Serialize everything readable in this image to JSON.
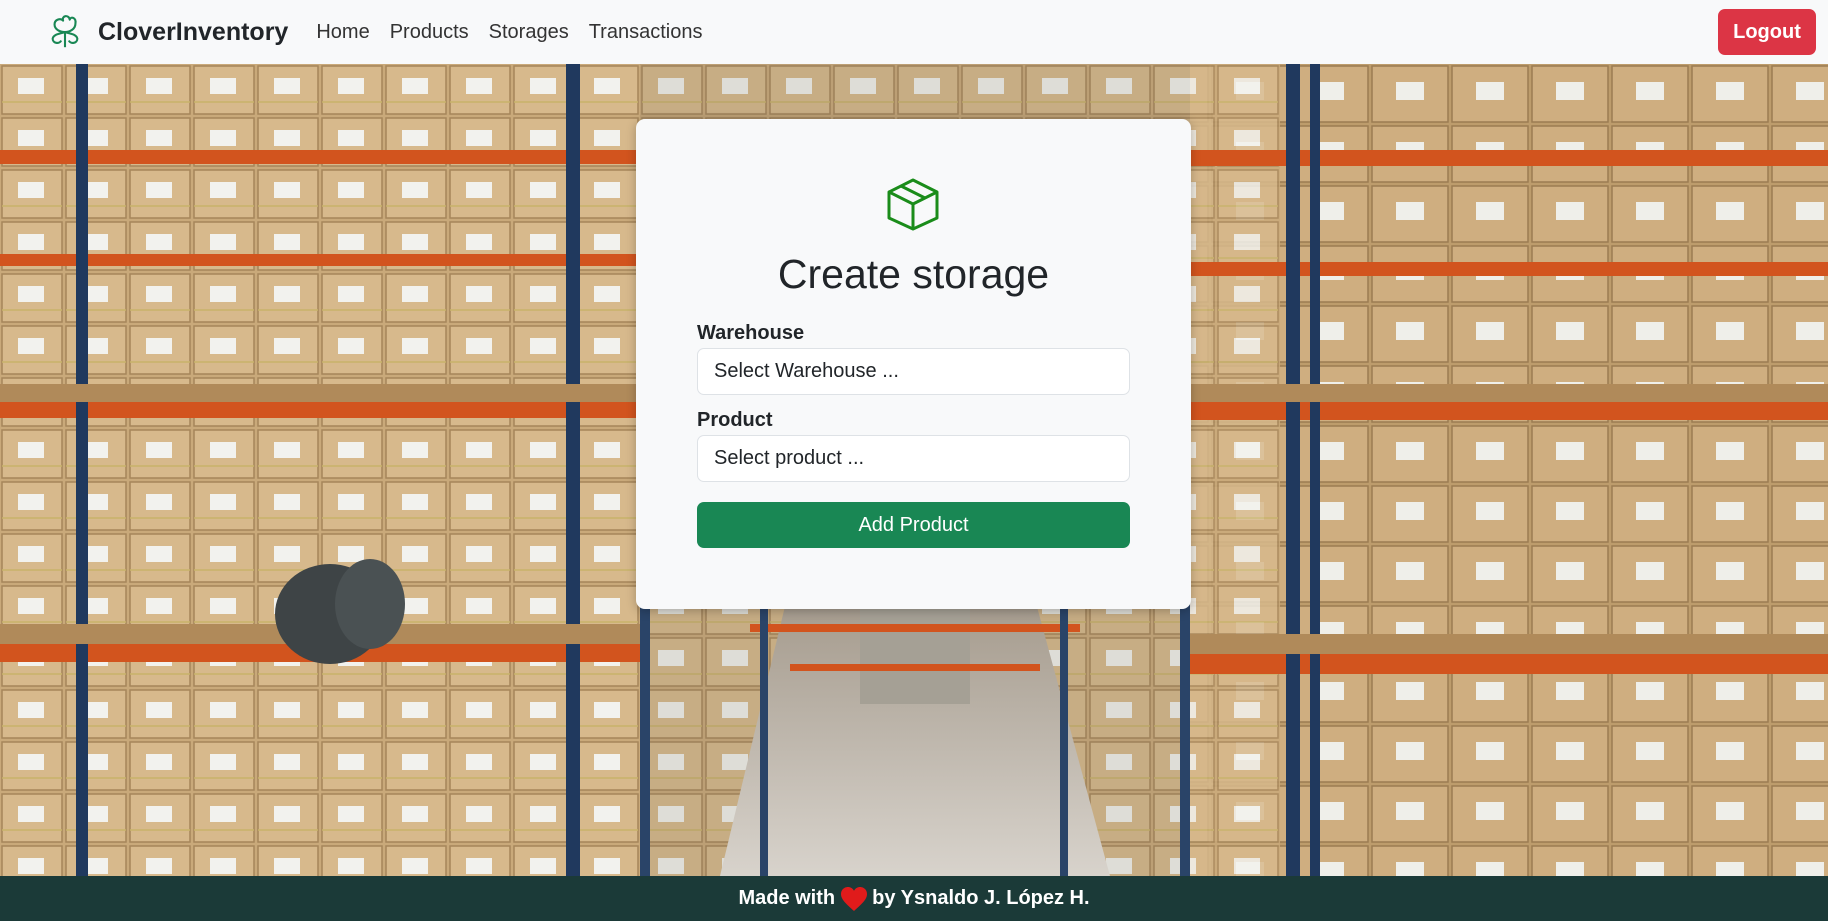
{
  "navbar": {
    "brand": "CloverInventory",
    "brand_icon": "clover-icon",
    "links": [
      "Home",
      "Products",
      "Storages",
      "Transactions"
    ],
    "logout_label": "Logout"
  },
  "form": {
    "icon": "box-icon",
    "title": "Create storage",
    "warehouse_label": "Warehouse",
    "warehouse_value": "Select Warehouse ...",
    "product_label": "Product",
    "product_value": "Select product ...",
    "submit_label": "Add Product"
  },
  "footer": {
    "prefix": "Made with",
    "heart_icon": "heart-icon",
    "suffix": "by Ysnaldo J. López H."
  },
  "colors": {
    "navbar_bg": "#f8f9fa",
    "brand_green": "#198754",
    "logout_red": "#dc3545",
    "footer_bg": "#1b3a38",
    "heart_red": "#e01b1b"
  }
}
